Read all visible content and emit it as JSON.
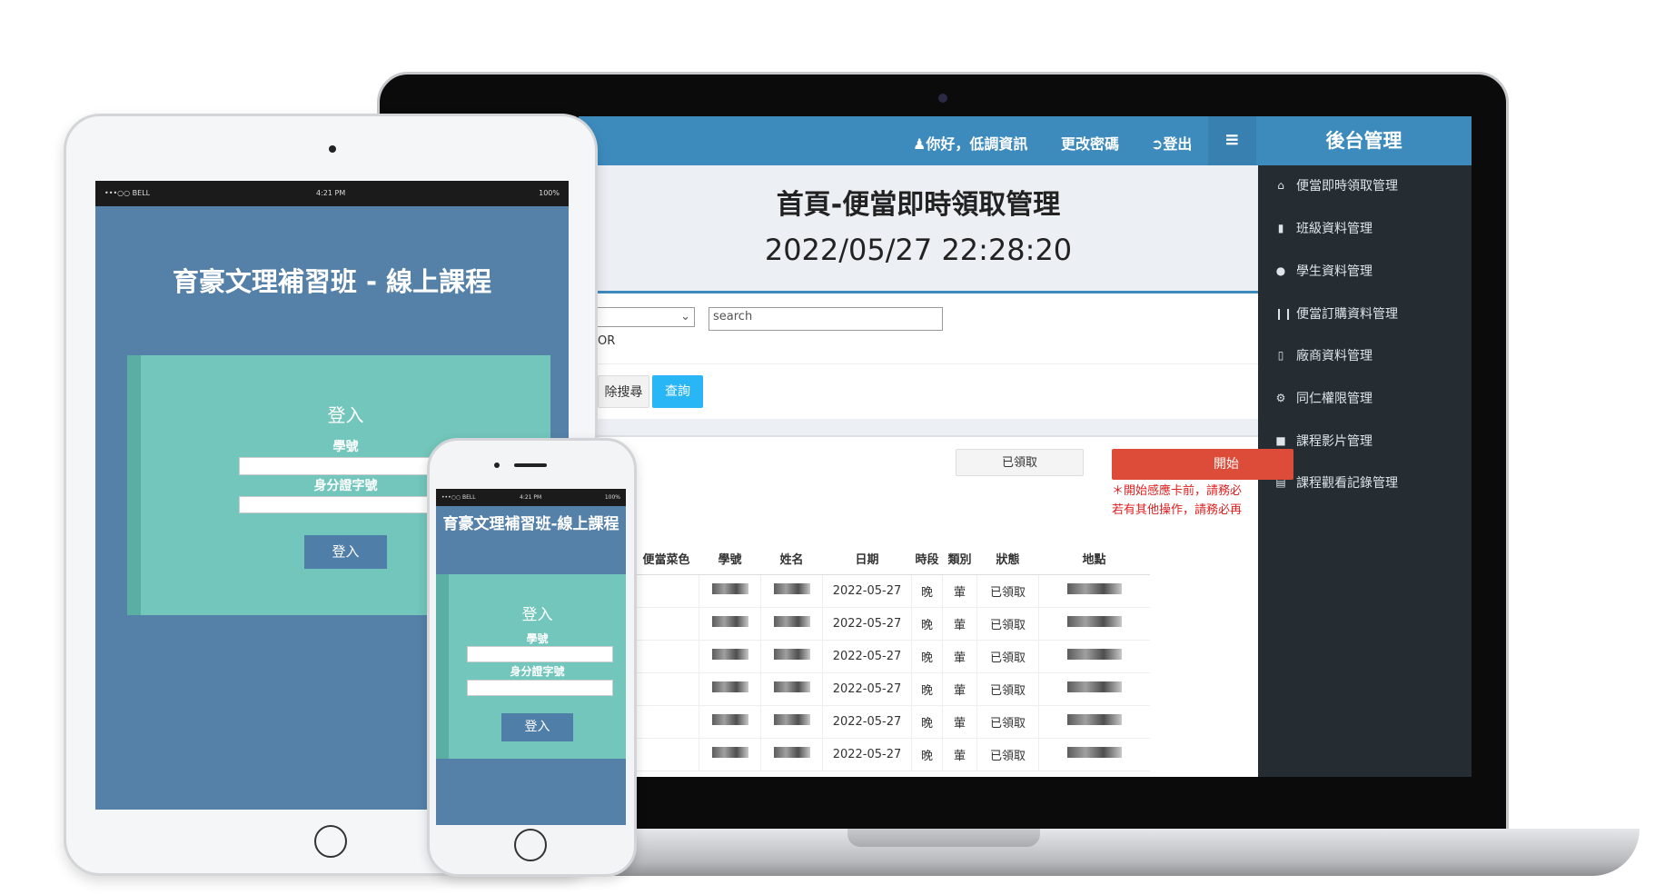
{
  "laptop": {
    "topbar": {
      "greeting": "你好，低調資訊",
      "change_password": "更改密碼",
      "logout": "登出",
      "menu_icon": "hamburger-icon",
      "brand": "後台管理"
    },
    "sidebar": {
      "items": [
        {
          "label": "便當即時領取管理",
          "icon": "home-icon"
        },
        {
          "label": "班級資料管理",
          "icon": "book-icon"
        },
        {
          "label": "學生資料管理",
          "icon": "users-icon"
        },
        {
          "label": "便當訂購資料管理",
          "icon": "cutlery-icon"
        },
        {
          "label": "廠商資料管理",
          "icon": "building-icon"
        },
        {
          "label": "同仁權限管理",
          "icon": "gear-icon"
        },
        {
          "label": "課程影片管理",
          "icon": "video-camera-icon"
        },
        {
          "label": "課程觀看記錄管理",
          "icon": "file-icon"
        }
      ]
    },
    "page": {
      "title": "首頁-便當即時領取管理",
      "datetime": "2022/05/27 22:28:20"
    },
    "filter": {
      "search_placeholder": "search",
      "or_label": "OR",
      "clear_button": "除搜尋",
      "query_button": "查詢"
    },
    "actions": {
      "received_button": "已領取",
      "start_button": "開始",
      "note_line1": "＊開始感應卡前，請務必",
      "note_line2": "若有其他操作，請務必再"
    },
    "table": {
      "headers": [
        "便當菜色",
        "學號",
        "姓名",
        "日期",
        "時段",
        "類別",
        "狀態",
        "地點"
      ],
      "rows": [
        {
          "date": "2022-05-27",
          "period": "晚",
          "type": "葷",
          "status": "已領取"
        },
        {
          "date": "2022-05-27",
          "period": "晚",
          "type": "葷",
          "status": "已領取"
        },
        {
          "date": "2022-05-27",
          "period": "晚",
          "type": "葷",
          "status": "已領取"
        },
        {
          "date": "2022-05-27",
          "period": "晚",
          "type": "葷",
          "status": "已領取"
        },
        {
          "date": "2022-05-27",
          "period": "晚",
          "type": "葷",
          "status": "已領取"
        },
        {
          "date": "2022-05-27",
          "period": "晚",
          "type": "葷",
          "status": "已領取"
        }
      ]
    }
  },
  "tablet": {
    "status": {
      "carrier": "•••○○ BELL",
      "time": "4:21 PM",
      "battery": "100%"
    },
    "title": "育豪文理補習班 - 線上課程",
    "login_heading": "登入",
    "student_id_label": "學號",
    "id_number_label": "身分證字號",
    "login_button": "登入"
  },
  "phone": {
    "status": {
      "carrier": "•••○○ BELL",
      "time": "4:21 PM",
      "battery": "100%"
    },
    "title": "育豪文理補習班-線上課程",
    "login_heading": "登入",
    "student_id_label": "學號",
    "id_number_label": "身分證字號",
    "login_button": "登入"
  },
  "colors": {
    "topbar": "#3d8bbd",
    "sidebar": "#252d33",
    "query_button": "#29b6f6",
    "start_button": "#dd4b39",
    "login_bg": "#5580a8",
    "login_card": "#72c6bc"
  }
}
